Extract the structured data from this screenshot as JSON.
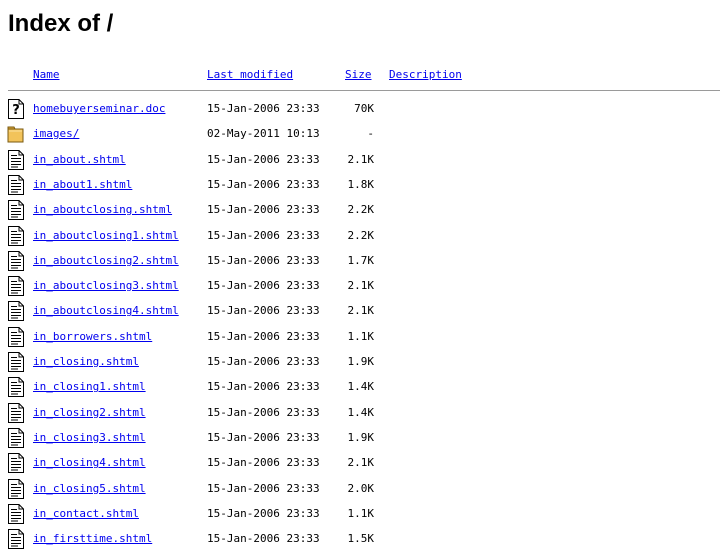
{
  "title": "Index of /",
  "columns": {
    "name": "Name",
    "modified": "Last modified",
    "size": "Size",
    "description": "Description"
  },
  "rows": [
    {
      "name": "homebuyerseminar.doc",
      "modified": "15-Jan-2006 23:33",
      "size": "70K",
      "icon": "unknown-file-icon"
    },
    {
      "name": "images/",
      "modified": "02-May-2011 10:13",
      "size": "-",
      "icon": "folder-icon"
    },
    {
      "name": "in_about.shtml",
      "modified": "15-Jan-2006 23:33",
      "size": "2.1K",
      "icon": "text-file-icon"
    },
    {
      "name": "in_about1.shtml",
      "modified": "15-Jan-2006 23:33",
      "size": "1.8K",
      "icon": "text-file-icon"
    },
    {
      "name": "in_aboutclosing.shtml",
      "modified": "15-Jan-2006 23:33",
      "size": "2.2K",
      "icon": "text-file-icon"
    },
    {
      "name": "in_aboutclosing1.shtml",
      "modified": "15-Jan-2006 23:33",
      "size": "2.2K",
      "icon": "text-file-icon"
    },
    {
      "name": "in_aboutclosing2.shtml",
      "modified": "15-Jan-2006 23:33",
      "size": "1.7K",
      "icon": "text-file-icon"
    },
    {
      "name": "in_aboutclosing3.shtml",
      "modified": "15-Jan-2006 23:33",
      "size": "2.1K",
      "icon": "text-file-icon"
    },
    {
      "name": "in_aboutclosing4.shtml",
      "modified": "15-Jan-2006 23:33",
      "size": "2.1K",
      "icon": "text-file-icon"
    },
    {
      "name": "in_borrowers.shtml",
      "modified": "15-Jan-2006 23:33",
      "size": "1.1K",
      "icon": "text-file-icon"
    },
    {
      "name": "in_closing.shtml",
      "modified": "15-Jan-2006 23:33",
      "size": "1.9K",
      "icon": "text-file-icon"
    },
    {
      "name": "in_closing1.shtml",
      "modified": "15-Jan-2006 23:33",
      "size": "1.4K",
      "icon": "text-file-icon"
    },
    {
      "name": "in_closing2.shtml",
      "modified": "15-Jan-2006 23:33",
      "size": "1.4K",
      "icon": "text-file-icon"
    },
    {
      "name": "in_closing3.shtml",
      "modified": "15-Jan-2006 23:33",
      "size": "1.9K",
      "icon": "text-file-icon"
    },
    {
      "name": "in_closing4.shtml",
      "modified": "15-Jan-2006 23:33",
      "size": "2.1K",
      "icon": "text-file-icon"
    },
    {
      "name": "in_closing5.shtml",
      "modified": "15-Jan-2006 23:33",
      "size": "2.0K",
      "icon": "text-file-icon"
    },
    {
      "name": "in_contact.shtml",
      "modified": "15-Jan-2006 23:33",
      "size": "1.1K",
      "icon": "text-file-icon"
    },
    {
      "name": "in_firsttime.shtml",
      "modified": "15-Jan-2006 23:33",
      "size": "1.5K",
      "icon": "text-file-icon"
    }
  ]
}
